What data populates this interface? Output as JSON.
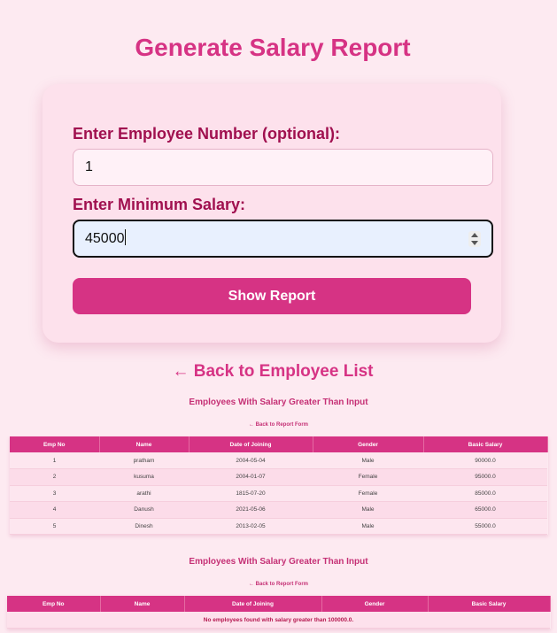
{
  "page": {
    "title": "Generate Salary Report"
  },
  "form": {
    "employee_label": "Enter Employee Number (optional):",
    "employee_value": "1",
    "salary_label": "Enter Minimum Salary:",
    "salary_value": "45000",
    "submit_label": "Show Report"
  },
  "back_link": "← Back to Employee List",
  "report1": {
    "title": "Employees With Salary Greater Than Input",
    "back_label": "← Back to Report Form",
    "headers": [
      "Emp No",
      "Name",
      "Date of Joining",
      "Gender",
      "Basic Salary"
    ],
    "rows": [
      [
        "1",
        "pratham",
        "2004-05-04",
        "Male",
        "90000.0"
      ],
      [
        "2",
        "kusuma",
        "2004-01-07",
        "Female",
        "95000.0"
      ],
      [
        "3",
        "arathi",
        "1815-07-20",
        "Female",
        "85000.0"
      ],
      [
        "4",
        "Danush",
        "2021-05-06",
        "Male",
        "65000.0"
      ],
      [
        "5",
        "Dinesh",
        "2013-02-05",
        "Male",
        "55000.0"
      ]
    ]
  },
  "report2": {
    "title": "Employees With Salary Greater Than Input",
    "back_label": "← Back to Report Form",
    "headers": [
      "Emp No",
      "Name",
      "Date of Joining",
      "Gender",
      "Basic Salary"
    ],
    "empty_message": "No employees found with salary greater than 100000.0."
  },
  "colors": {
    "accent": "#d63384",
    "background": "#fdeaf1",
    "card": "#fde1ec",
    "label": "#a0104f"
  }
}
